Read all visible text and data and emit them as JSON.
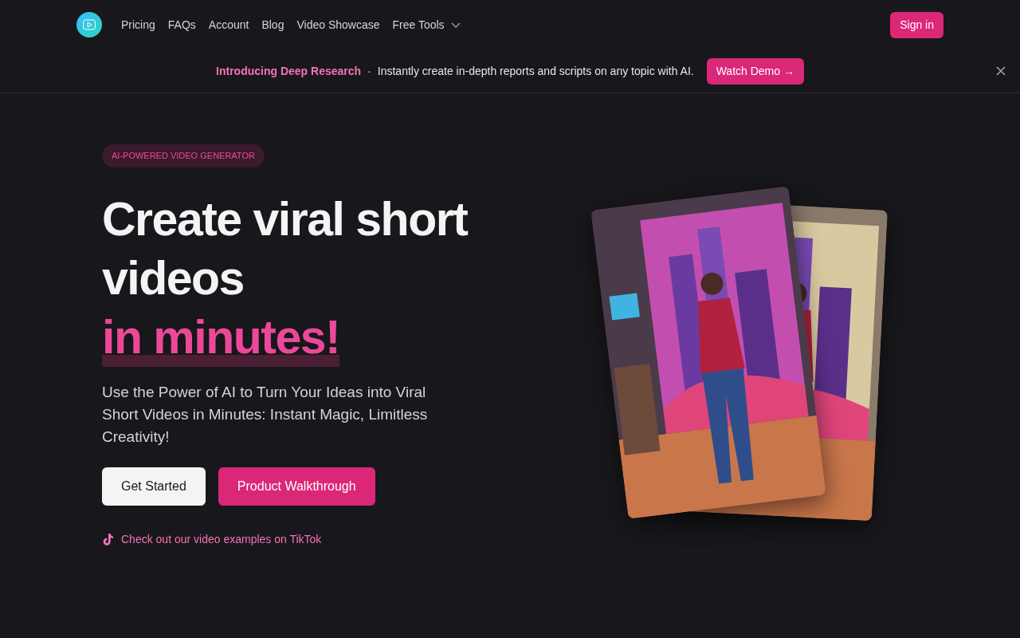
{
  "nav": {
    "links": [
      {
        "label": "Pricing",
        "dropdown": false
      },
      {
        "label": "FAQs",
        "dropdown": false
      },
      {
        "label": "Account",
        "dropdown": false
      },
      {
        "label": "Blog",
        "dropdown": false
      },
      {
        "label": "Video Showcase",
        "dropdown": false
      },
      {
        "label": "Free Tools",
        "dropdown": true
      }
    ],
    "sign_in": "Sign in"
  },
  "banner": {
    "title": "Introducing Deep Research",
    "separator": "·",
    "text": "Instantly create in-depth reports and scripts on any topic with AI.",
    "button": "Watch Demo →"
  },
  "hero": {
    "badge": "AI-POWERED VIDEO GENERATOR",
    "title": "Create viral short videos",
    "highlight": "in minutes!",
    "subtitle": "Use the Power of AI to Turn Your Ideas into Viral Short Videos in Minutes: Instant Magic, Limitless Creativity!",
    "buttons": [
      {
        "label": "Get Started",
        "kind": "light"
      },
      {
        "label": "Product Walkthrough",
        "kind": "primary"
      }
    ],
    "tiktok_link": "Check out our video examples on TikTok"
  }
}
